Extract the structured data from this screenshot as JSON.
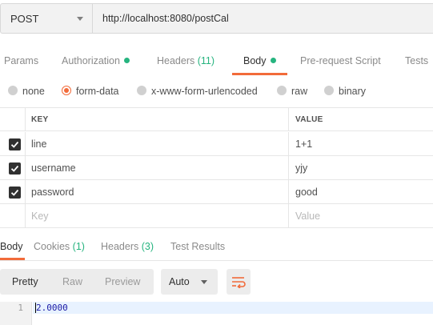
{
  "request": {
    "method": "POST",
    "url": "http://localhost:8080/postCal"
  },
  "request_tabs": [
    {
      "label": "Params"
    },
    {
      "label": "Authorization",
      "indicator": "dot"
    },
    {
      "label": "Headers",
      "count": "(11)"
    },
    {
      "label": "Body",
      "indicator": "dot",
      "active": true
    },
    {
      "label": "Pre-request Script"
    },
    {
      "label": "Tests"
    }
  ],
  "body_types": [
    {
      "label": "none",
      "selected": false
    },
    {
      "label": "form-data",
      "selected": true
    },
    {
      "label": "x-www-form-urlencoded",
      "selected": false
    },
    {
      "label": "raw",
      "selected": false
    },
    {
      "label": "binary",
      "selected": false
    }
  ],
  "form_table": {
    "headers": {
      "key": "KEY",
      "value": "VALUE"
    },
    "rows": [
      {
        "checked": true,
        "key": "line",
        "value": "1+1"
      },
      {
        "checked": true,
        "key": "username",
        "value": "yjy"
      },
      {
        "checked": true,
        "key": "password",
        "value": "good"
      }
    ],
    "placeholder": {
      "key": "Key",
      "value": "Value"
    }
  },
  "response_tabs": [
    {
      "label": "Body",
      "active": true
    },
    {
      "label": "Cookies",
      "count": "(1)"
    },
    {
      "label": "Headers",
      "count": "(3)"
    },
    {
      "label": "Test Results"
    }
  ],
  "response_toolbar": {
    "views": [
      "Pretty",
      "Raw",
      "Preview"
    ],
    "active_view": "Pretty",
    "format": "Auto",
    "wrap_icon": "wrap-lines-icon"
  },
  "editor": {
    "line_number": "1",
    "content": "2.0000"
  },
  "colors": {
    "accent": "#f26b3a",
    "indicator": "#26b47f",
    "number_text": "#1a1aa6"
  }
}
